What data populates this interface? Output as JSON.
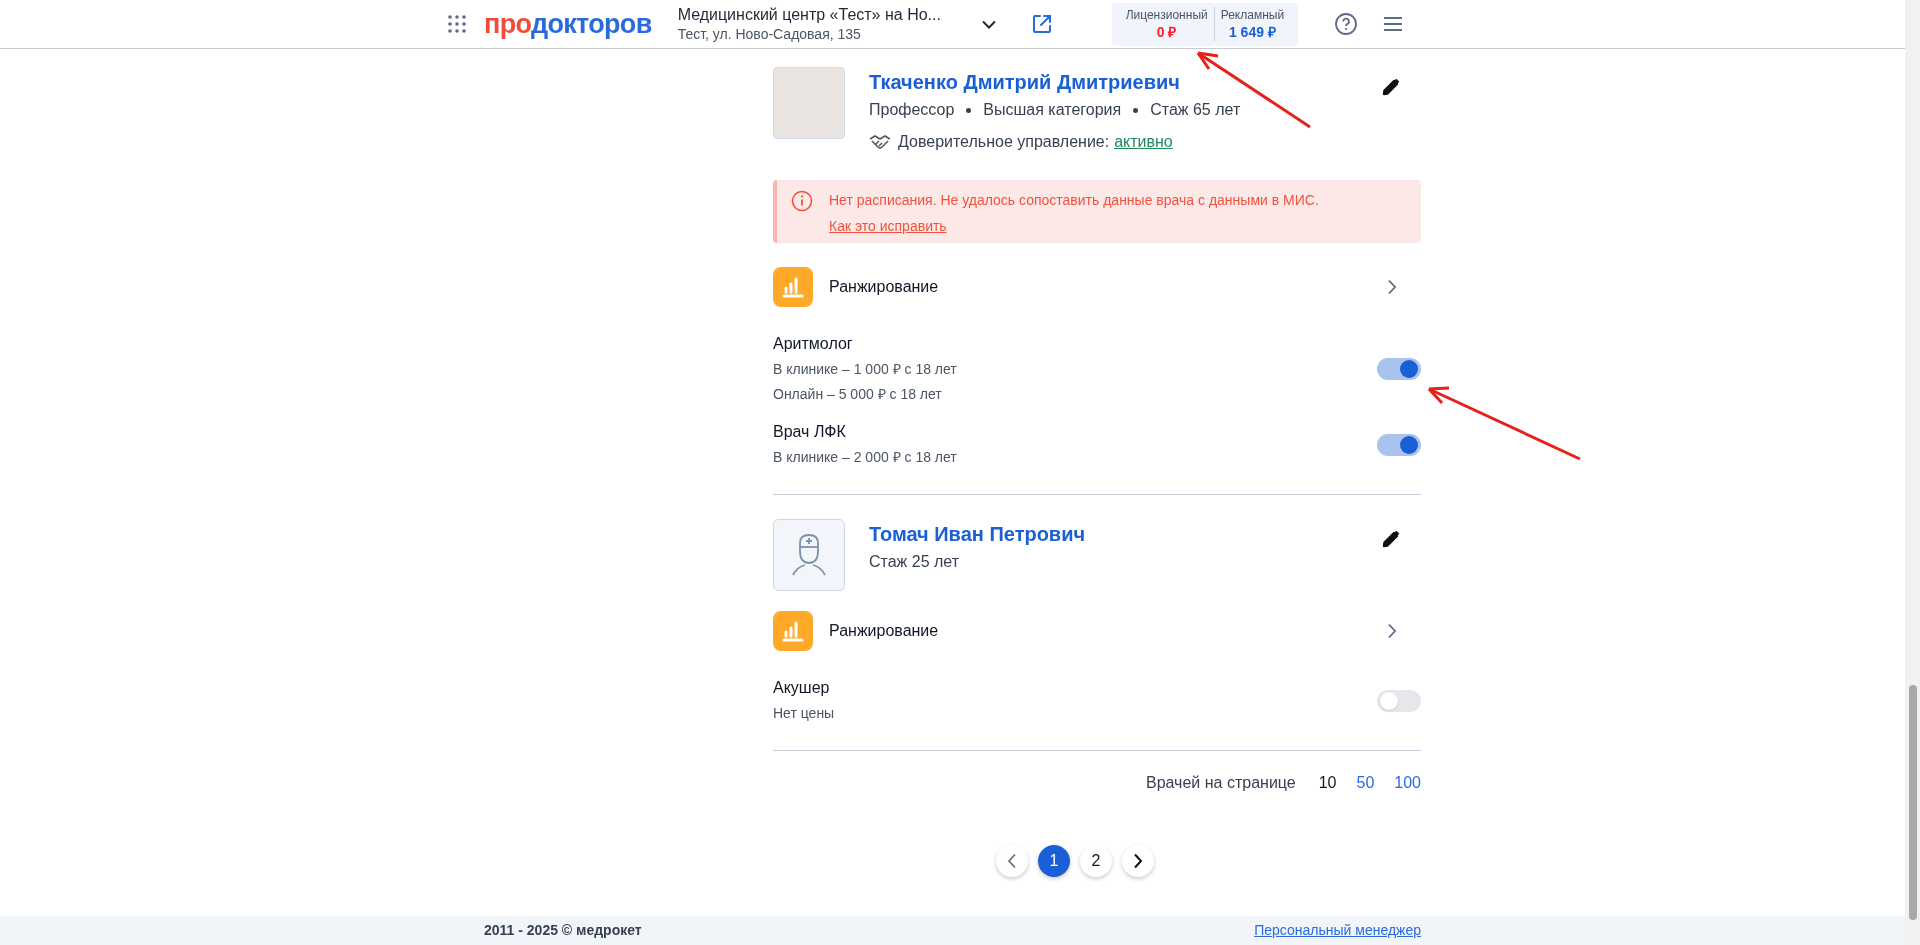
{
  "header": {
    "logo": {
      "prefix": "про",
      "rest": "докторов"
    },
    "clinic_name": "Медицинский центр «Тест» на Но...",
    "clinic_address": "Тест, ул. Ново-Садовая, 135",
    "balances": [
      {
        "label": "Лицензионный",
        "value": "0 ₽",
        "color": "#f5222d"
      },
      {
        "label": "Рекламный",
        "value": "1 649 ₽",
        "color": "#1a5fd6"
      }
    ]
  },
  "doctors": [
    {
      "name": "Ткаченко Дмитрий Дмитриевич",
      "kind": "photo",
      "meta": [
        "Профессор",
        "Высшая категория",
        "Стаж 65 лет"
      ],
      "trust": {
        "label": "Доверительное управление:",
        "status": "активно"
      },
      "alert": {
        "message": "Нет расписания. Не удалось сопоставить данные врача с данными в МИС.",
        "link": "Как это исправить"
      },
      "ranking": "Ранжирование",
      "specialties": [
        {
          "name": "Аритмолог",
          "prices": [
            "В клинике – 1 000 ₽ с 18 лет",
            "Онлайн – 5 000 ₽ с 18 лет"
          ],
          "on": true
        },
        {
          "name": "Врач ЛФК",
          "prices": [
            "В клинике – 2 000 ₽ с 18 лет"
          ],
          "on": true
        }
      ]
    },
    {
      "name": "Томач Иван Петрович",
      "kind": "silhouette",
      "meta": [
        "Стаж 25 лет"
      ],
      "ranking": "Ранжирование",
      "specialties": [
        {
          "name": "Акушер",
          "prices": [
            "Нет цены"
          ],
          "on": false
        }
      ]
    }
  ],
  "per_page": {
    "label": "Врачей на странице",
    "options": [
      {
        "label": "10",
        "selected": true
      },
      {
        "label": "50",
        "selected": false
      },
      {
        "label": "100",
        "selected": false
      }
    ]
  },
  "pagination": {
    "pages": [
      {
        "label": "1",
        "selected": true
      },
      {
        "label": "2",
        "selected": false
      }
    ]
  },
  "footer": {
    "copyright": "2011 - 2025 © медрокет",
    "link": "Персональный менеджер"
  }
}
